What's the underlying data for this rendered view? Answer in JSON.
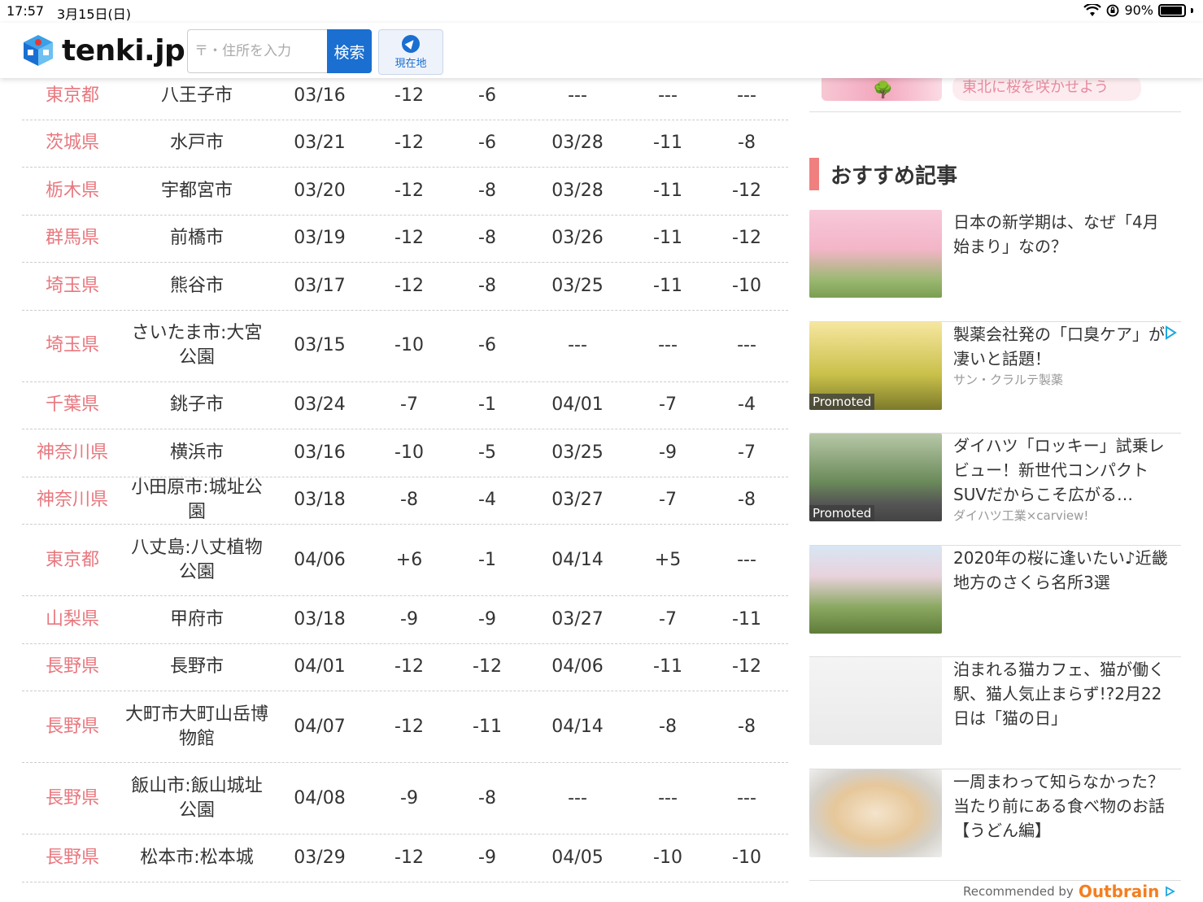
{
  "status_bar": {
    "time": "17:57",
    "date": "3月15日(日)",
    "battery": "90%"
  },
  "header": {
    "logo": "tenki.jp",
    "search_placeholder": "〒・住所を入力",
    "search_button": "検索",
    "location_button": "現在地"
  },
  "table_rows": [
    {
      "pref": "東京都",
      "city": "八王子市",
      "d1": "03/16",
      "n1": "-12",
      "n2": "-6",
      "d2": "---",
      "n3": "---",
      "n4": "---",
      "tall": false
    },
    {
      "pref": "茨城県",
      "city": "水戸市",
      "d1": "03/21",
      "n1": "-12",
      "n2": "-6",
      "d2": "03/28",
      "n3": "-11",
      "n4": "-8",
      "tall": false
    },
    {
      "pref": "栃木県",
      "city": "宇都宮市",
      "d1": "03/20",
      "n1": "-12",
      "n2": "-8",
      "d2": "03/28",
      "n3": "-11",
      "n4": "-12",
      "tall": false
    },
    {
      "pref": "群馬県",
      "city": "前橋市",
      "d1": "03/19",
      "n1": "-12",
      "n2": "-8",
      "d2": "03/26",
      "n3": "-11",
      "n4": "-12",
      "tall": false
    },
    {
      "pref": "埼玉県",
      "city": "熊谷市",
      "d1": "03/17",
      "n1": "-12",
      "n2": "-8",
      "d2": "03/25",
      "n3": "-11",
      "n4": "-10",
      "tall": false
    },
    {
      "pref": "埼玉県",
      "city": "さいたま市:大宮公園",
      "d1": "03/15",
      "n1": "-10",
      "n2": "-6",
      "d2": "---",
      "n3": "---",
      "n4": "---",
      "tall": true
    },
    {
      "pref": "千葉県",
      "city": "銚子市",
      "d1": "03/24",
      "n1": "-7",
      "n2": "-1",
      "d2": "04/01",
      "n3": "-7",
      "n4": "-4",
      "tall": false
    },
    {
      "pref": "神奈川県",
      "city": "横浜市",
      "d1": "03/16",
      "n1": "-10",
      "n2": "-5",
      "d2": "03/25",
      "n3": "-9",
      "n4": "-7",
      "tall": false
    },
    {
      "pref": "神奈川県",
      "city": "小田原市:城址公園",
      "d1": "03/18",
      "n1": "-8",
      "n2": "-4",
      "d2": "03/27",
      "n3": "-7",
      "n4": "-8",
      "tall": false
    },
    {
      "pref": "東京都",
      "city": "八丈島:八丈植物公園",
      "d1": "04/06",
      "n1": "+6",
      "n2": "-1",
      "d2": "04/14",
      "n3": "+5",
      "n4": "---",
      "tall": true
    },
    {
      "pref": "山梨県",
      "city": "甲府市",
      "d1": "03/18",
      "n1": "-9",
      "n2": "-9",
      "d2": "03/27",
      "n3": "-7",
      "n4": "-11",
      "tall": false
    },
    {
      "pref": "長野県",
      "city": "長野市",
      "d1": "04/01",
      "n1": "-12",
      "n2": "-12",
      "d2": "04/06",
      "n3": "-11",
      "n4": "-12",
      "tall": false
    },
    {
      "pref": "長野県",
      "city": "大町市大町山岳博物館",
      "d1": "04/07",
      "n1": "-12",
      "n2": "-11",
      "d2": "04/14",
      "n3": "-8",
      "n4": "-8",
      "tall": true
    },
    {
      "pref": "長野県",
      "city": "飯山市:飯山城址公園",
      "d1": "04/08",
      "n1": "-9",
      "n2": "-8",
      "d2": "---",
      "n3": "---",
      "n4": "---",
      "tall": true
    },
    {
      "pref": "長野県",
      "city": "松本市:松本城",
      "d1": "03/29",
      "n1": "-12",
      "n2": "-9",
      "d2": "04/05",
      "n3": "-10",
      "n4": "-10",
      "tall": false
    }
  ],
  "sidebar": {
    "banner_text": "東北に桜を咲かせよう",
    "section_title": "おすすめ記事",
    "articles": [
      {
        "title": "日本の新学期は、なぜ「4月始まり」なの？",
        "source": "",
        "promoted": ""
      },
      {
        "title": "製薬会社発の「口臭ケア」が凄いと話題！",
        "source": "サン・クラルテ製薬",
        "promoted": "Promoted"
      },
      {
        "title": "ダイハツ「ロッキー」試乗レビュー！新世代コンパクトSUVだからこそ広がる…",
        "source": "ダイハツ工業×carview!",
        "promoted": "Promoted"
      },
      {
        "title": "2020年の桜に逢いたい♪近畿地方のさくら名所3選",
        "source": "",
        "promoted": ""
      },
      {
        "title": "泊まれる猫カフェ、猫が働く駅、猫人気止まらず!?2月22日は「猫の日」",
        "source": "",
        "promoted": ""
      },
      {
        "title": "一周まわって知らなかった？当たり前にある食べ物のお話【うどん編】",
        "source": "",
        "promoted": ""
      }
    ],
    "recommended_by": "Recommended by",
    "outbrain": "Outbrain"
  },
  "colors": {
    "pref_text": "#e8787f",
    "accent": "#1a6fd1",
    "section_bar": "#f08080"
  }
}
